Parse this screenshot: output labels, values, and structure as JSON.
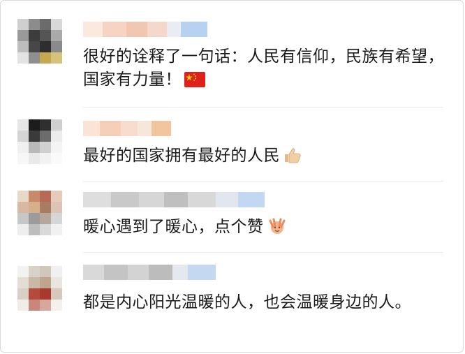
{
  "comments": [
    {
      "text": "很好的诠释了一句话：人民有信仰，民族有希望，国家有力量！",
      "emoji": "china-flag-icon"
    },
    {
      "text": "最好的国家拥有最好的人民",
      "emoji": "thumbs-up-icon"
    },
    {
      "text": "暖心遇到了暖心，点个赞",
      "emoji": "victory-hands-icon"
    },
    {
      "text": "都是内心阳光温暖的人，也会温暖身边的人。",
      "emoji": ""
    }
  ],
  "colors": {
    "text": "#1a1a1a",
    "divider": "#ececec",
    "nick_blur_a": "#f7d9c9",
    "nick_blur_b": "#b9d3f2"
  }
}
